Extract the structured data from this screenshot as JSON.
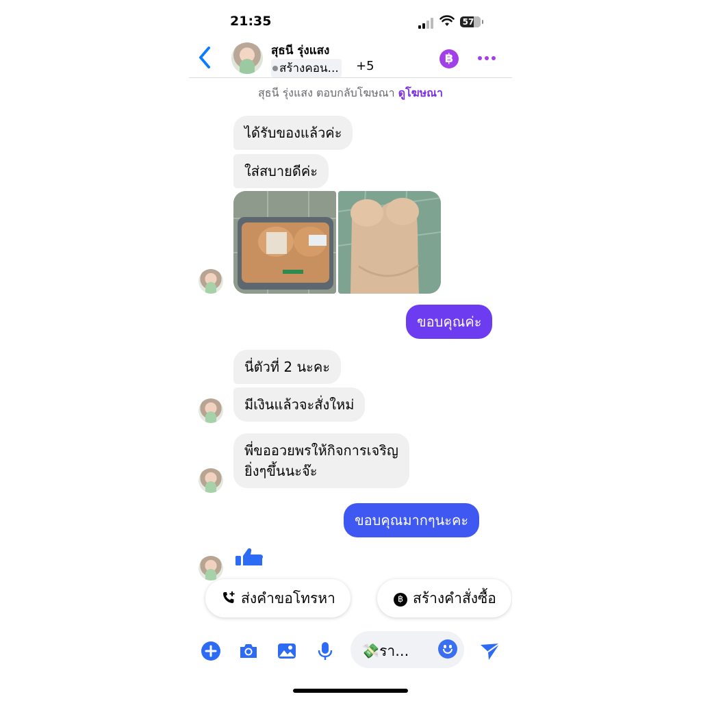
{
  "status_bar": {
    "time": "21:35",
    "battery": "57"
  },
  "header": {
    "contact_name": "สุธนี รุ่งแสง",
    "subtitle": "สร้างคอน...",
    "extra_count": "+5",
    "coin_icon_text": "฿"
  },
  "chat": {
    "ad_note_text": "สุธนี รุ่งแสง ตอบกลับโฆษณา",
    "ad_note_link": "ดูโฆษณา",
    "messages": [
      {
        "from": "contact",
        "text": "ได้รับของแล้วค่ะ"
      },
      {
        "from": "contact",
        "text": "ใส่สบายดีค่ะ"
      },
      {
        "from": "contact",
        "type": "photos",
        "count": 2
      },
      {
        "from": "me",
        "text": "ขอบคุณค่ะ"
      },
      {
        "from": "contact",
        "text": "นี่ตัวที่ 2 นะคะ"
      },
      {
        "from": "contact",
        "text": "มีเงินแล้วจะสั่งใหม่"
      },
      {
        "from": "contact",
        "text_line1": "พี่ขออวยพรให้กิจการเจริญ",
        "text_line2": "ยิ่งๆขึ้นนะจ๊ะ"
      },
      {
        "from": "me",
        "text": "ขอบคุณมากๆนะคะ"
      },
      {
        "from": "contact",
        "type": "like"
      }
    ]
  },
  "quick_replies": [
    {
      "label": "ส่งคำขอโทรหา",
      "icon": "phone-plus-icon"
    },
    {
      "label": "สร้างคำสั่งซื้อ",
      "icon": "coin-icon"
    }
  ],
  "composer": {
    "draft_text": "💸รา...",
    "buttons": [
      "plus-icon",
      "camera-icon",
      "gallery-icon",
      "mic-icon",
      "emoji-icon",
      "send-icon"
    ]
  },
  "colors": {
    "accent_blue": "#0a7cff",
    "accent_purple": "#a23fe8",
    "bubble_out_top": "#6b3cf0",
    "bubble_out_bottom": "#3a5cf3",
    "bubble_in": "#f0f0f0"
  }
}
